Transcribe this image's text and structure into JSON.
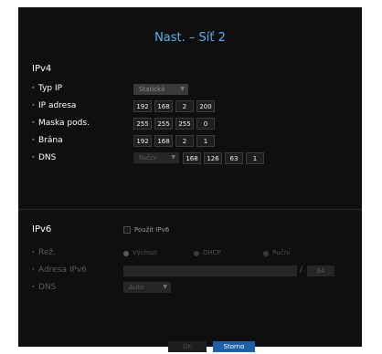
{
  "title": "Nast. – Síť 2",
  "ipv4": {
    "heading": "IPv4",
    "type_ip": {
      "label": "Typ IP",
      "value": "Statická"
    },
    "ip_address": {
      "label": "IP adresa",
      "octets": [
        "192",
        "168",
        "2",
        "200"
      ]
    },
    "subnet_mask": {
      "label": "Maska pods.",
      "octets": [
        "255",
        "255",
        "255",
        "0"
      ]
    },
    "gateway": {
      "label": "Brána",
      "octets": [
        "192",
        "168",
        "2",
        "1"
      ]
    },
    "dns": {
      "label": "DNS",
      "mode": "Ruční",
      "octets": [
        "168",
        "126",
        "63",
        "1"
      ]
    }
  },
  "ipv6": {
    "heading": "IPv6",
    "use_label": "Použít IPv6",
    "mode": {
      "label": "Rež.",
      "options": [
        "Výchozí",
        "DHCP",
        "Ruční"
      ],
      "selected": "Výchozí"
    },
    "address": {
      "label": "Adresa IPv6",
      "value": "",
      "prefix": "64"
    },
    "dns": {
      "label": "DNS",
      "value": "Auto"
    }
  },
  "buttons": {
    "ok": "OK",
    "cancel": "Storno"
  }
}
